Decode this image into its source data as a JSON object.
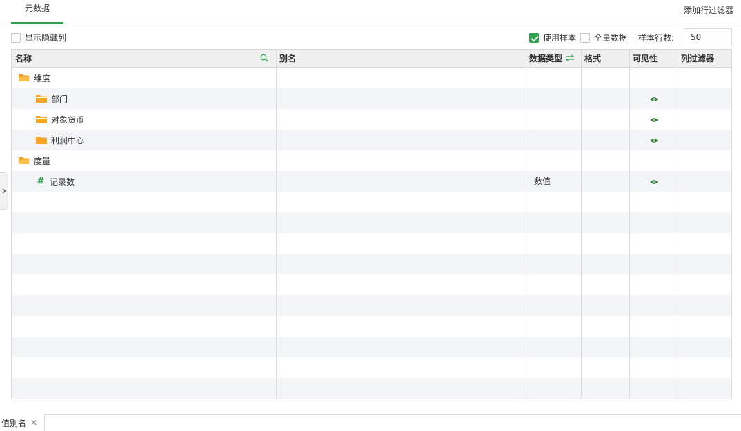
{
  "tabs": [
    {
      "label": "元数据"
    }
  ],
  "header_actions": {
    "add_row_filter": "添加行过滤器"
  },
  "toolbar": {
    "show_hidden_columns": {
      "label": "显示隐藏列",
      "checked": false
    },
    "use_sample": {
      "label": "使用样本",
      "checked": true
    },
    "full_data": {
      "label": "全量数据",
      "checked": false
    },
    "sample_rows_label": "样本行数:",
    "sample_rows_value": "50"
  },
  "columns": {
    "name": "名称",
    "alias": "别名",
    "data_type": "数据类型",
    "format": "格式",
    "visibility": "可见性",
    "column_filter": "列过滤器"
  },
  "rows": [
    {
      "label": "维度",
      "kind": "folder-open",
      "level": 0,
      "data_type": "",
      "visible": false
    },
    {
      "label": "部门",
      "kind": "folder",
      "level": 1,
      "data_type": "",
      "visible": true
    },
    {
      "label": "对象货币",
      "kind": "folder",
      "level": 1,
      "data_type": "",
      "visible": true
    },
    {
      "label": "利润中心",
      "kind": "folder",
      "level": 1,
      "data_type": "",
      "visible": true
    },
    {
      "label": "度量",
      "kind": "folder-open",
      "level": 0,
      "data_type": "",
      "visible": false
    },
    {
      "label": "记录数",
      "kind": "measure",
      "level": 1,
      "data_type": "数值",
      "visible": true
    }
  ],
  "bottom": {
    "tab_label": "值别名"
  },
  "colors": {
    "accent": "#2da44e",
    "folder": "#f5a623",
    "eye": "#2e7d32",
    "header_bg": "#f0f0f0",
    "alt_row": "#f4f5f7"
  },
  "icons": {
    "search": "search-icon",
    "swap": "swap-icon",
    "eye": "eye-icon",
    "folder": "folder-icon",
    "folder_open": "folder-open-icon",
    "hash": "hash-icon",
    "chevron": "chevron-right-icon",
    "close": "close-icon"
  }
}
